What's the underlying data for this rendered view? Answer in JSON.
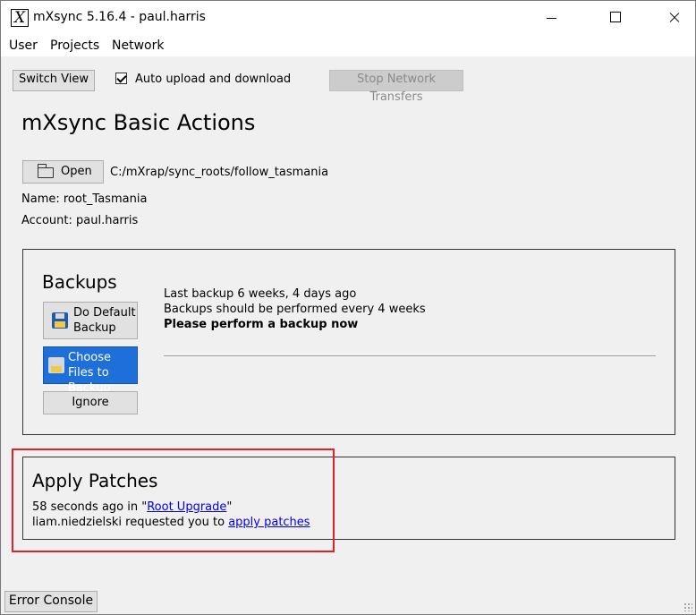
{
  "window": {
    "title": "mXsync 5.16.4 - paul.harris",
    "app_icon_glyph": "X"
  },
  "menu": [
    "User",
    "Projects",
    "Network"
  ],
  "toolbar": {
    "switch_view": "Switch View",
    "auto_upload_label": "Auto upload and download",
    "auto_upload_checked": true,
    "stop_transfers": "Stop Network Transfers"
  },
  "main": {
    "heading": "mXsync Basic Actions",
    "open_button": "Open",
    "path": "C:/mXrap/sync_roots/follow_tasmania",
    "name_line": "Name: root_Tasmania",
    "account_line": "Account: paul.harris"
  },
  "backups": {
    "title": "Backups",
    "default_backup": "Do Default Backup",
    "choose_files": "Choose Files to Backup",
    "ignore": "Ignore",
    "last_backup": "Last backup 6 weeks, 4 days ago",
    "frequency": "Backups should be performed every 4 weeks",
    "warning": "Please perform a backup now"
  },
  "patches": {
    "title": "Apply Patches",
    "line1_prefix": "58 seconds ago in \"",
    "line1_link": "Root Upgrade",
    "line1_suffix": "\"",
    "line2_prefix": "liam.niedzielski requested you to ",
    "line2_link": "apply patches"
  },
  "footer": {
    "error_console": "Error Console"
  },
  "colors": {
    "primary_button": "#1e6fd9",
    "highlight_border": "#e0202a",
    "link": "#0000ee"
  }
}
